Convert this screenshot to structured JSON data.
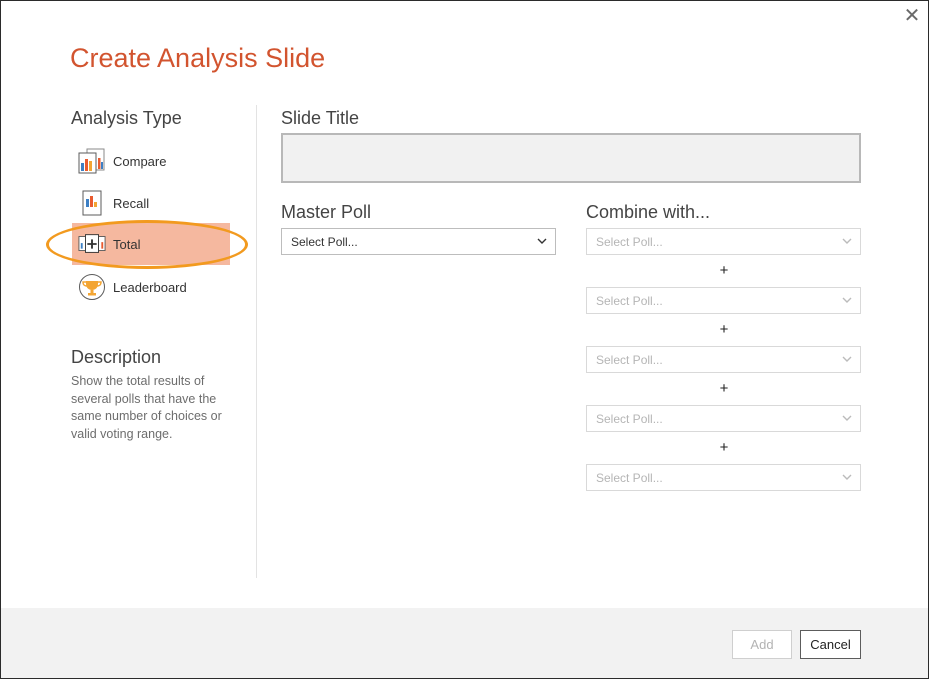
{
  "dialog": {
    "title": "Create Analysis Slide",
    "close_label": "✕"
  },
  "analysis_type": {
    "heading": "Analysis Type",
    "items": [
      {
        "label": "Compare",
        "icon": "compare-icon"
      },
      {
        "label": "Recall",
        "icon": "recall-icon"
      },
      {
        "label": "Total",
        "icon": "total-icon",
        "selected": true
      },
      {
        "label": "Leaderboard",
        "icon": "trophy-icon"
      }
    ]
  },
  "description": {
    "heading": "Description",
    "text": "Show the total results of several polls that have the same number of choices or valid voting range."
  },
  "slide_title": {
    "label": "Slide Title",
    "value": ""
  },
  "master_poll": {
    "label": "Master Poll",
    "value": "Select Poll..."
  },
  "combine": {
    "label": "Combine with...",
    "plus": "+",
    "selects": [
      {
        "value": "Select Poll..."
      },
      {
        "value": "Select Poll..."
      },
      {
        "value": "Select Poll..."
      },
      {
        "value": "Select Poll..."
      },
      {
        "value": "Select Poll..."
      }
    ]
  },
  "footer": {
    "add_label": "Add",
    "cancel_label": "Cancel"
  },
  "colors": {
    "accent": "#d2542f",
    "selected_bg": "#f5b89f",
    "highlight_ring": "#f29a1f"
  }
}
